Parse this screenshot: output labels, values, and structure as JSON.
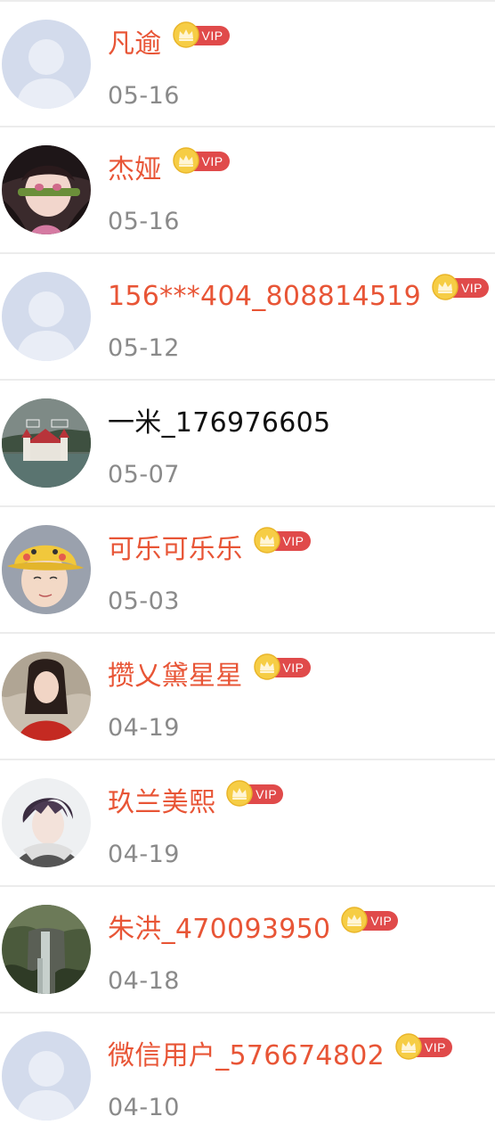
{
  "rows": [
    {
      "name": "凡逾",
      "date": "05-16",
      "vip": true,
      "vip_label": "VIP",
      "avatar": "default-avatar"
    },
    {
      "name": "杰娅",
      "date": "05-16",
      "vip": true,
      "vip_label": "VIP",
      "avatar": "anime-girl-avatar"
    },
    {
      "name": "156***404_808814519",
      "date": "05-12",
      "vip": true,
      "vip_label": "VIP",
      "avatar": "default-avatar"
    },
    {
      "name": "一米_176976605",
      "date": "05-07",
      "vip": false,
      "vip_label": "",
      "avatar": "castle-lake-avatar"
    },
    {
      "name": "可乐可乐乐",
      "date": "05-03",
      "vip": true,
      "vip_label": "VIP",
      "avatar": "pikachu-hat-avatar"
    },
    {
      "name": "攒乂黛星星",
      "date": "04-19",
      "vip": true,
      "vip_label": "VIP",
      "avatar": "girl-red-scarf-avatar"
    },
    {
      "name": "玖兰美熙",
      "date": "04-19",
      "vip": true,
      "vip_label": "VIP",
      "avatar": "anime-boy-avatar"
    },
    {
      "name": "朱洪_470093950",
      "date": "04-18",
      "vip": true,
      "vip_label": "VIP",
      "avatar": "waterfall-avatar"
    },
    {
      "name": "微信用户_576674802",
      "date": "04-10",
      "vip": true,
      "vip_label": "VIP",
      "avatar": "default-avatar"
    }
  ],
  "colors": {
    "vip_name": "#e85536",
    "plain_name": "#111111",
    "date": "#8a8a8a",
    "vip_pill": "#e04a4a",
    "coin": "#f4c53a",
    "default_avatar_bg": "#d3dbec"
  }
}
